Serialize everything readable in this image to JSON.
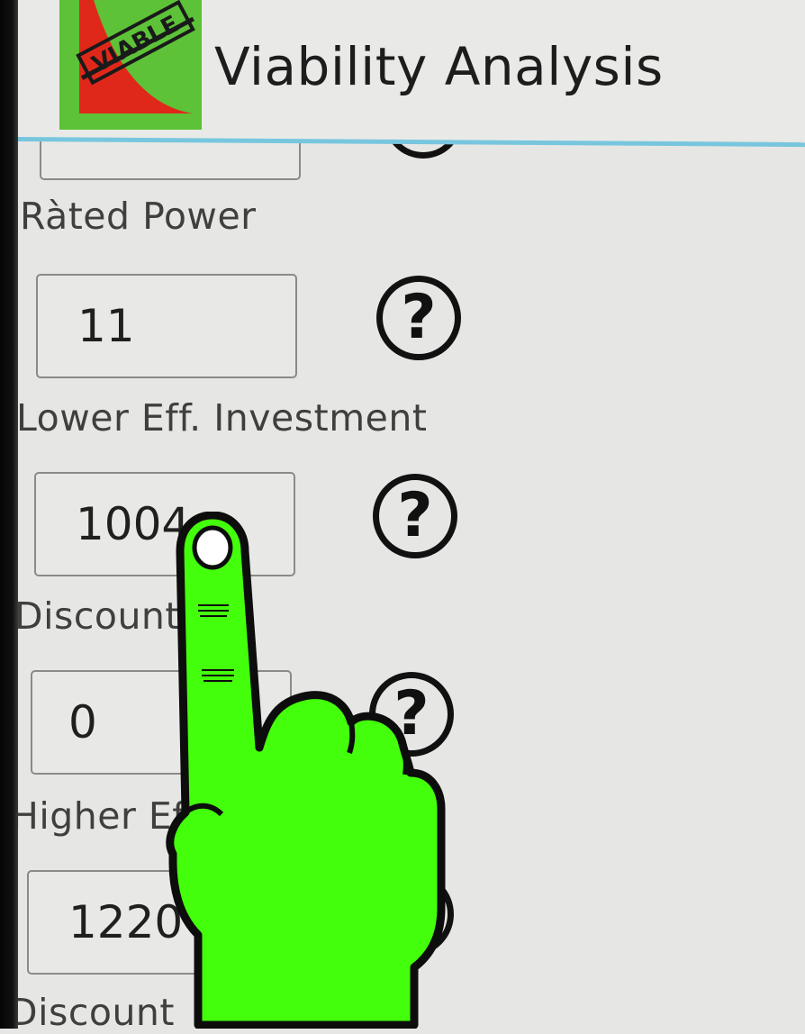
{
  "header": {
    "title": "Viability Analysis",
    "logo_text": "VIABLE"
  },
  "form": {
    "fields": [
      {
        "label": "",
        "value": ""
      },
      {
        "label": "Ràted Power",
        "value": "11"
      },
      {
        "label": "Lower Eff. Investment",
        "value": "1004"
      },
      {
        "label": "Discount",
        "value": "0"
      },
      {
        "label": "Higher Ef",
        "value": "1220"
      },
      {
        "label": "Discount",
        "value": ""
      }
    ],
    "help_glyph": "?"
  },
  "overlay": {
    "hand_icon": "pointing-hand-icon",
    "hand_color": "#44ff0b"
  },
  "colors": {
    "accent_divider": "#78c6de",
    "logo_green": "#5dc238",
    "logo_red": "#e0281a"
  }
}
